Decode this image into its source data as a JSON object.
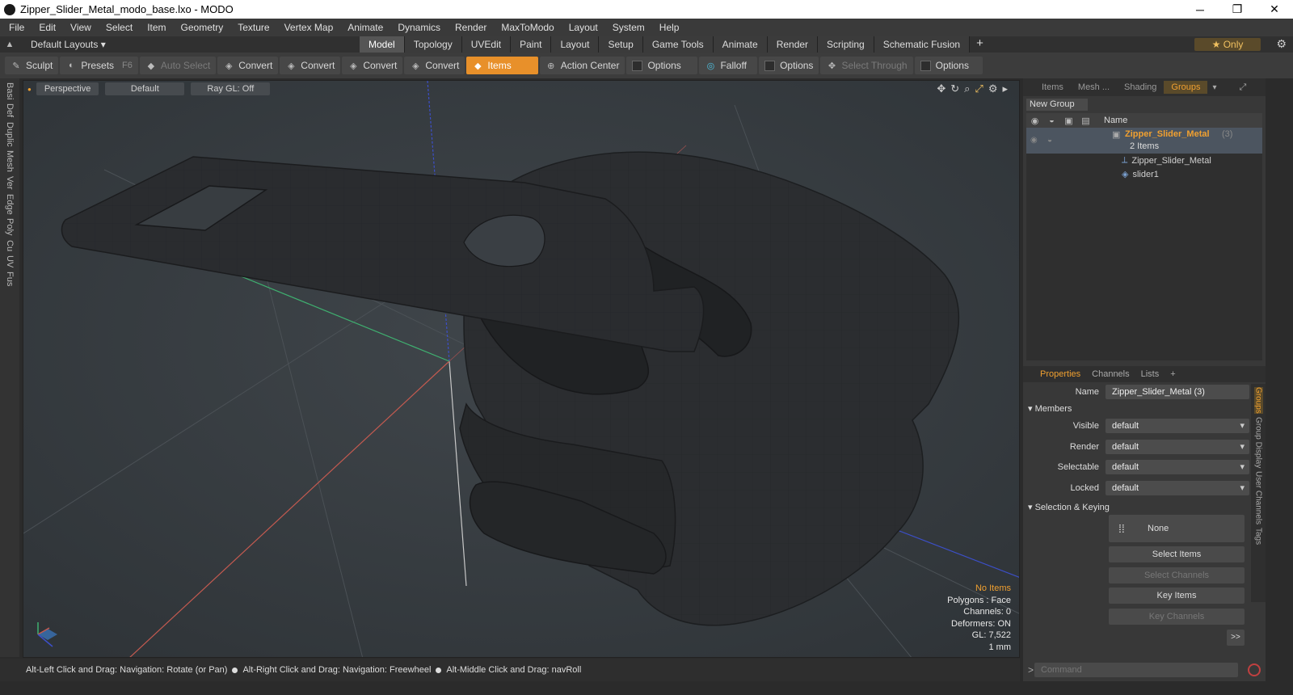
{
  "window": {
    "title": "Zipper_Slider_Metal_modo_base.lxo - MODO",
    "minimize": "─",
    "restore": "❐",
    "close": "✕"
  },
  "menu": [
    "File",
    "Edit",
    "View",
    "Select",
    "Item",
    "Geometry",
    "Texture",
    "Vertex Map",
    "Animate",
    "Dynamics",
    "Render",
    "MaxToModo",
    "Layout",
    "System",
    "Help"
  ],
  "layoutbar": {
    "layouts_label": "Default Layouts ▾",
    "tabs": [
      "Model",
      "Topology",
      "UVEdit",
      "Paint",
      "Layout",
      "Setup",
      "Game Tools",
      "Animate",
      "Render",
      "Scripting",
      "Schematic Fusion"
    ],
    "active_tab": "Model",
    "add_tab": "+",
    "only_label": "★  Only"
  },
  "toolbar": {
    "sculpt": "Sculpt",
    "presets": "Presets",
    "presets_key": "F6",
    "auto_select": "Auto Select",
    "convert_1": "Convert",
    "convert_2": "Convert",
    "convert_3": "Convert",
    "convert_4": "Convert",
    "items": "Items",
    "action_center": "Action Center",
    "options_1": "Options",
    "falloff": "Falloff",
    "options_2": "Options",
    "select_through": "Select Through",
    "options_3": "Options"
  },
  "left_strip": [
    "Basi",
    "Def",
    "Duplic",
    "Mesh",
    "Ver",
    "Edge",
    "Poly",
    "Cu",
    "UV",
    "Fus"
  ],
  "viewport": {
    "view": "Perspective",
    "shading": "Default",
    "raygl": "Ray GL: Off",
    "stats": {
      "items": "No Items",
      "polygons": "Polygons : Face",
      "channels": "Channels: 0",
      "deformers": "Deformers: ON",
      "gl": "GL: 7,522",
      "unit": "1 mm"
    }
  },
  "statusbar": {
    "hint1": "Alt-Left Click and Drag: Navigation: Rotate (or Pan)",
    "hint2": "Alt-Right Click and Drag: Navigation: Freewheel",
    "hint3": "Alt-Middle Click and Drag: navRoll"
  },
  "right_panel": {
    "tabs": [
      "Items",
      "Mesh ...",
      "Shading",
      "Groups"
    ],
    "active_tab": "Groups",
    "new_group": "New Group",
    "tree_header_name": "Name",
    "group": {
      "name": "Zipper_Slider_Metal",
      "count": "(3)",
      "items_label": "2 Items"
    },
    "children": [
      "Zipper_Slider_Metal",
      "slider1"
    ],
    "props_tabs": [
      "Properties",
      "Channels",
      "Lists",
      "+"
    ],
    "name_label": "Name",
    "name_value": "Zipper_Slider_Metal (3)",
    "members_label": "Members",
    "fields": [
      {
        "label": "Visible",
        "value": "default"
      },
      {
        "label": "Render",
        "value": "default"
      },
      {
        "label": "Selectable",
        "value": "default"
      },
      {
        "label": "Locked",
        "value": "default"
      }
    ],
    "selection_keying": "Selection & Keying",
    "none_label": "None",
    "select_items": "Select Items",
    "select_channels": "Select Channels",
    "key_items": "Key Items",
    "key_channels": "Key Channels",
    "more": ">>",
    "side_tabs": [
      "Groups",
      "Group Display",
      "User Channels",
      "Tags"
    ],
    "command_placeholder": "Command"
  }
}
